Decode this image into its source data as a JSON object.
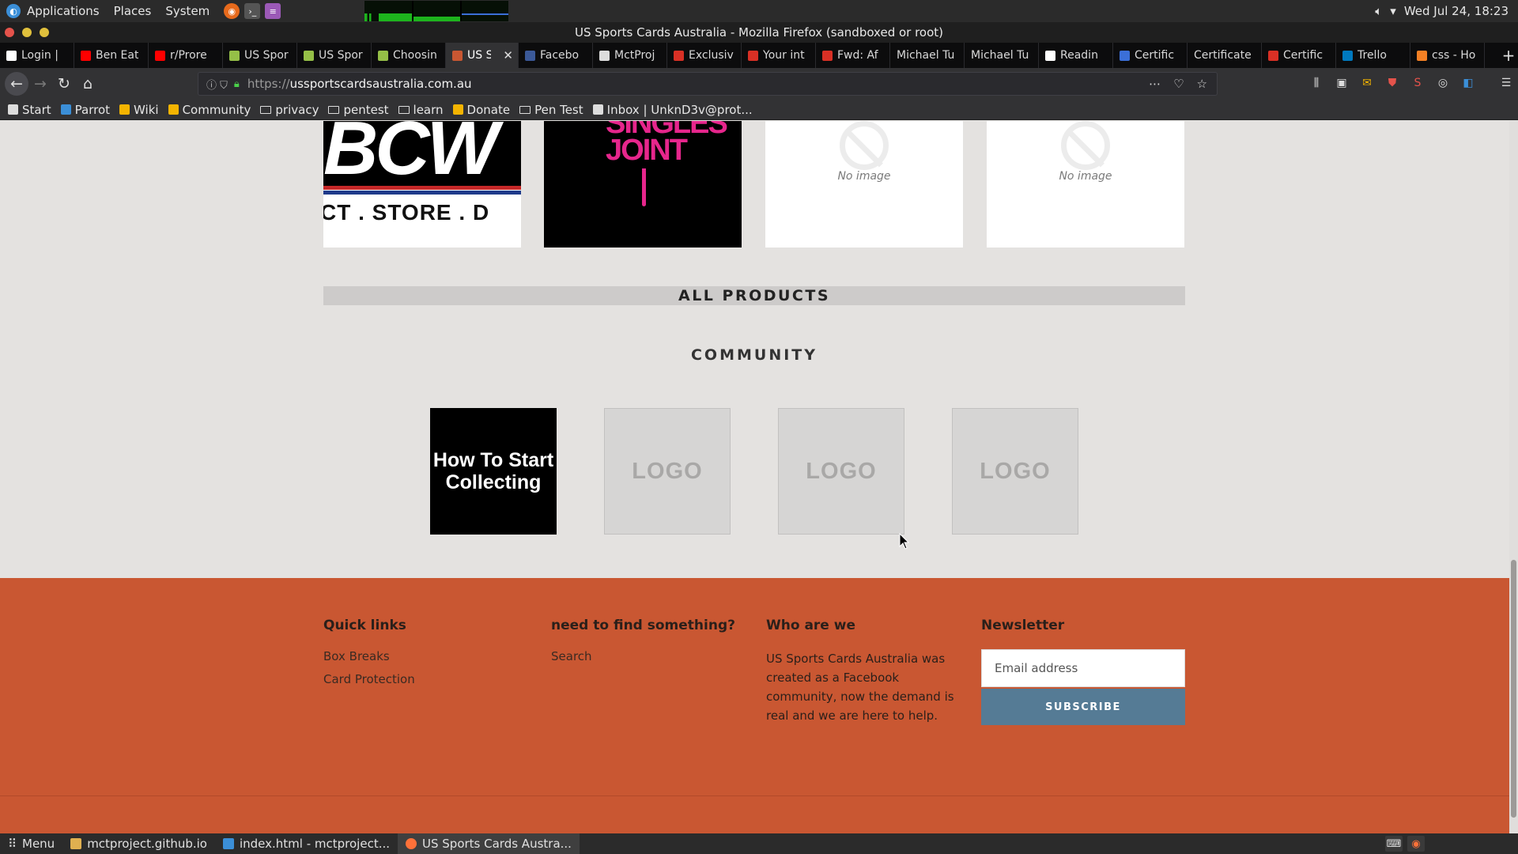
{
  "system_panel": {
    "menus": [
      "Applications",
      "Places",
      "System"
    ],
    "clock": "Wed Jul 24, 18:23"
  },
  "window": {
    "title": "US Sports Cards Australia - Mozilla Firefox (sandboxed or root)"
  },
  "tabs": [
    {
      "label": "Login | ",
      "icon_color": "#ffffff"
    },
    {
      "label": "Ben Eat",
      "icon_color": "#ff0000"
    },
    {
      "label": "r/Prore",
      "icon_color": "#ff0000"
    },
    {
      "label": "US Spor",
      "icon_color": "#95bf47"
    },
    {
      "label": "US Spor",
      "icon_color": "#95bf47"
    },
    {
      "label": "Choosin",
      "icon_color": "#95bf47"
    },
    {
      "label": "US Sp",
      "icon_color": "#c95732",
      "active": true
    },
    {
      "label": "Facebo",
      "icon_color": "#3b5998"
    },
    {
      "label": "MctProj",
      "icon_color": "#dddddd"
    },
    {
      "label": "Exclusiv",
      "icon_color": "#d93025"
    },
    {
      "label": "Your int",
      "icon_color": "#d93025"
    },
    {
      "label": "Fwd: Af",
      "icon_color": "#d93025"
    },
    {
      "label": "Michael Tu",
      "icon_color": ""
    },
    {
      "label": "Michael Tu",
      "icon_color": ""
    },
    {
      "label": "Readin",
      "icon_color": "#ffffff"
    },
    {
      "label": "Certific",
      "icon_color": "#3b6fd8"
    },
    {
      "label": "Certificate",
      "icon_color": ""
    },
    {
      "label": "Certific",
      "icon_color": "#d93025"
    },
    {
      "label": "Trello",
      "icon_color": "#0079bf"
    },
    {
      "label": "css - Ho",
      "icon_color": "#f48024"
    }
  ],
  "navbar": {
    "url_proto": "https://",
    "url_host": "ussportscardsaustralia.com.au",
    "more_icon": "three-dots-icon",
    "pocket_icon": "pocket-icon",
    "bookmark_star_icon": "star-icon"
  },
  "bookmarks": [
    {
      "label": "Start",
      "type": "link",
      "icon_color": "#dddddd"
    },
    {
      "label": "Parrot",
      "type": "link",
      "icon_color": "#3b8fd8"
    },
    {
      "label": "Wiki",
      "type": "link",
      "icon_color": "#f4b400"
    },
    {
      "label": "Community",
      "type": "link",
      "icon_color": "#f4b400"
    },
    {
      "label": "privacy",
      "type": "folder"
    },
    {
      "label": "pentest",
      "type": "folder"
    },
    {
      "label": "learn",
      "type": "folder"
    },
    {
      "label": "Donate",
      "type": "link",
      "icon_color": "#f4b400"
    },
    {
      "label": "Pen Test",
      "type": "folder"
    },
    {
      "label": "Inbox | UnknD3v@prot...",
      "type": "link",
      "icon_color": "#dddddd"
    }
  ],
  "page": {
    "products_row": [
      {
        "kind": "bcw",
        "brand_top": "BCW",
        "brand_bottom": "CT . STORE . D"
      },
      {
        "kind": "singles",
        "text": "SINGLES JOINT"
      },
      {
        "kind": "no-image",
        "label": "No image"
      },
      {
        "kind": "no-image",
        "label": "No image"
      }
    ],
    "all_products_label": "ALL PRODUCTS",
    "community_title": "COMMUNITY",
    "community_tiles": [
      {
        "label": "How To Start Collecting"
      },
      {
        "label": "LOGO"
      },
      {
        "label": "LOGO"
      },
      {
        "label": "LOGO"
      }
    ]
  },
  "footer": {
    "quick_links": {
      "title": "Quick links",
      "links": [
        "Box Breaks",
        "Card Protection"
      ]
    },
    "need": {
      "title": "need to find something?",
      "links": [
        "Search"
      ]
    },
    "who": {
      "title": "Who are we",
      "text": "US Sports Cards Australia was created as a Facebook community, now the demand is real and we are here to help."
    },
    "newsletter": {
      "title": "Newsletter",
      "email_placeholder": "Email address",
      "subscribe_label": "SUBSCRIBE"
    },
    "background_color": "#c95732"
  },
  "taskbar": {
    "menu_label": "Menu",
    "tasks": [
      {
        "label": "mctproject.github.io",
        "icon_color": "#e0b050"
      },
      {
        "label": "index.html - mctproject...",
        "icon_color": "#3b8fd8"
      },
      {
        "label": "US Sports Cards Austra...",
        "icon_color": "#ff7139",
        "active": true
      }
    ]
  }
}
